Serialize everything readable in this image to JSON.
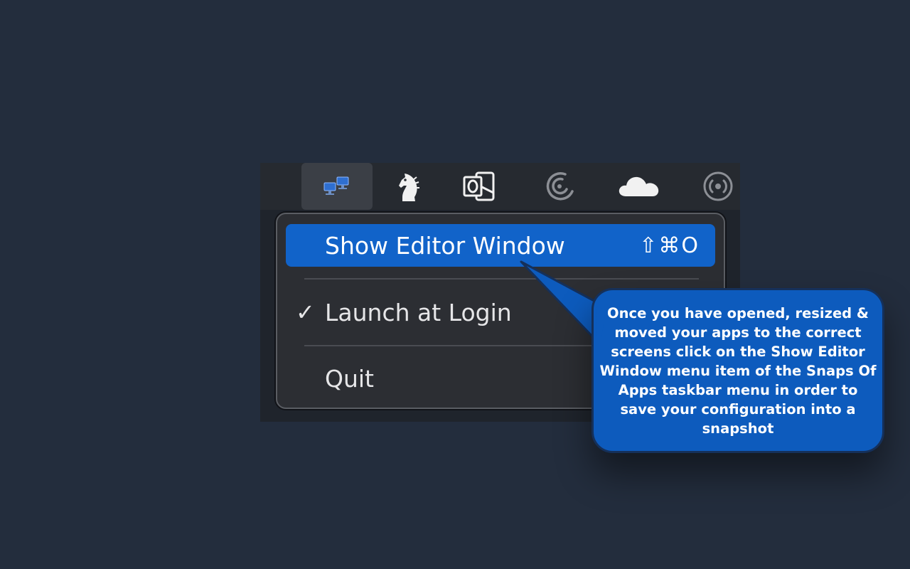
{
  "menubar": {
    "items": [
      {
        "icon": "snaps-of-apps-icon",
        "active": true
      },
      {
        "icon": "chess-knight-icon",
        "active": false
      },
      {
        "icon": "outlook-icon",
        "active": false
      },
      {
        "icon": "radar-arc-icon",
        "active": false
      },
      {
        "icon": "onedrive-cloud-icon",
        "active": false
      },
      {
        "icon": "broadcast-icon",
        "active": false
      }
    ]
  },
  "menu": {
    "show_editor": {
      "label": "Show Editor Window",
      "shortcut": "⇧⌘O"
    },
    "launch_at_login": {
      "label": "Launch at Login",
      "check": "✓"
    },
    "quit": {
      "label": "Quit"
    }
  },
  "callout": {
    "text": "Once you have opened, resized & moved your apps to the correct screens click on the Show Editor Window menu item of the Snaps Of Apps taskbar menu in order to save your configuration into a snapshot"
  },
  "colors": {
    "background": "#232d3d",
    "highlight": "#1163c9",
    "callout": "#0d5bbd"
  }
}
